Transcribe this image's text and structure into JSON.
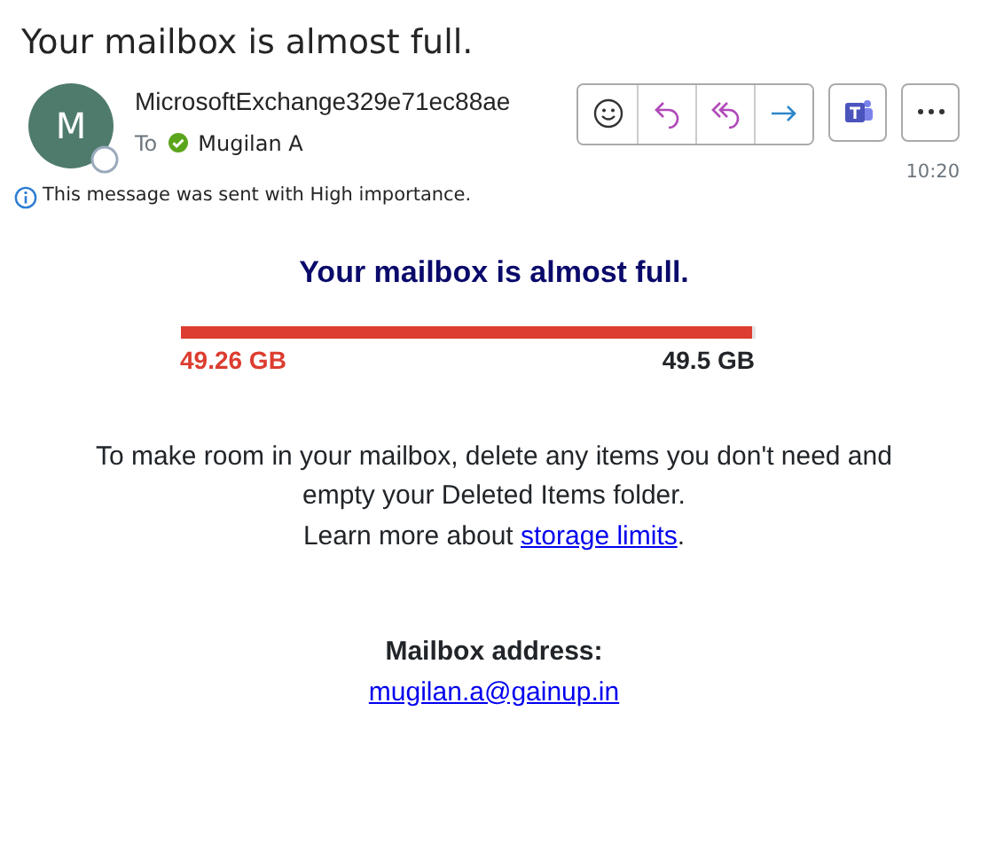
{
  "subject": "Your mailbox is almost full.",
  "sender": {
    "initial": "M",
    "name": "MicrosoftExchange329e71ec88ae",
    "to_label": "To",
    "recipient": "Mugilan A",
    "time": "10:20"
  },
  "importance_note": "This message was sent with High importance.",
  "body": {
    "heading": "Your mailbox is almost full.",
    "quota": {
      "level": 0.995,
      "used": "49.26 GB",
      "limit": "49.5 GB"
    },
    "paragraph": "To make room in your mailbox, delete any items you don't need and empty your Deleted Items folder.",
    "learn_prefix": "Learn more about ",
    "learn_link": "storage limits",
    "learn_suffix": ".",
    "address_label": "Mailbox address:",
    "address": "mugilan.a@gainup.in"
  }
}
